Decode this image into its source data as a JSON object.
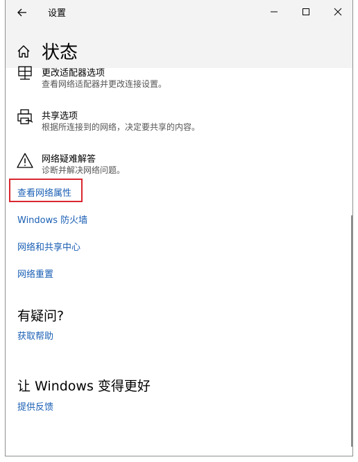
{
  "window": {
    "app_title": "设置",
    "page_title": "状态",
    "controls": {
      "back": "back-arrow-icon",
      "minimize": "minimize-icon",
      "maximize": "maximize-icon",
      "close": "close-icon"
    }
  },
  "options": [
    {
      "icon": "network-adapter-icon",
      "title": "更改适配器选项",
      "desc": "查看网络适配器并更改连接设置。"
    },
    {
      "icon": "sharing-printer-icon",
      "title": "共享选项",
      "desc": "根据所连接到的网络，决定要共享的内容。"
    },
    {
      "icon": "warning-icon",
      "title": "网络疑难解答",
      "desc": "诊断并解决网络问题。"
    }
  ],
  "links": [
    {
      "label": "查看网络属性"
    },
    {
      "label": "Windows 防火墙"
    },
    {
      "label": "网络和共享中心"
    },
    {
      "label": "网络重置"
    }
  ],
  "help": {
    "heading": "有疑问?",
    "link": "获取帮助"
  },
  "feedback": {
    "heading": "让 Windows 变得更好",
    "link": "提供反馈"
  },
  "colors": {
    "link": "#1a5fb4",
    "highlight_border": "#d9262e",
    "titlebar_bg": "#f3f3f3"
  }
}
